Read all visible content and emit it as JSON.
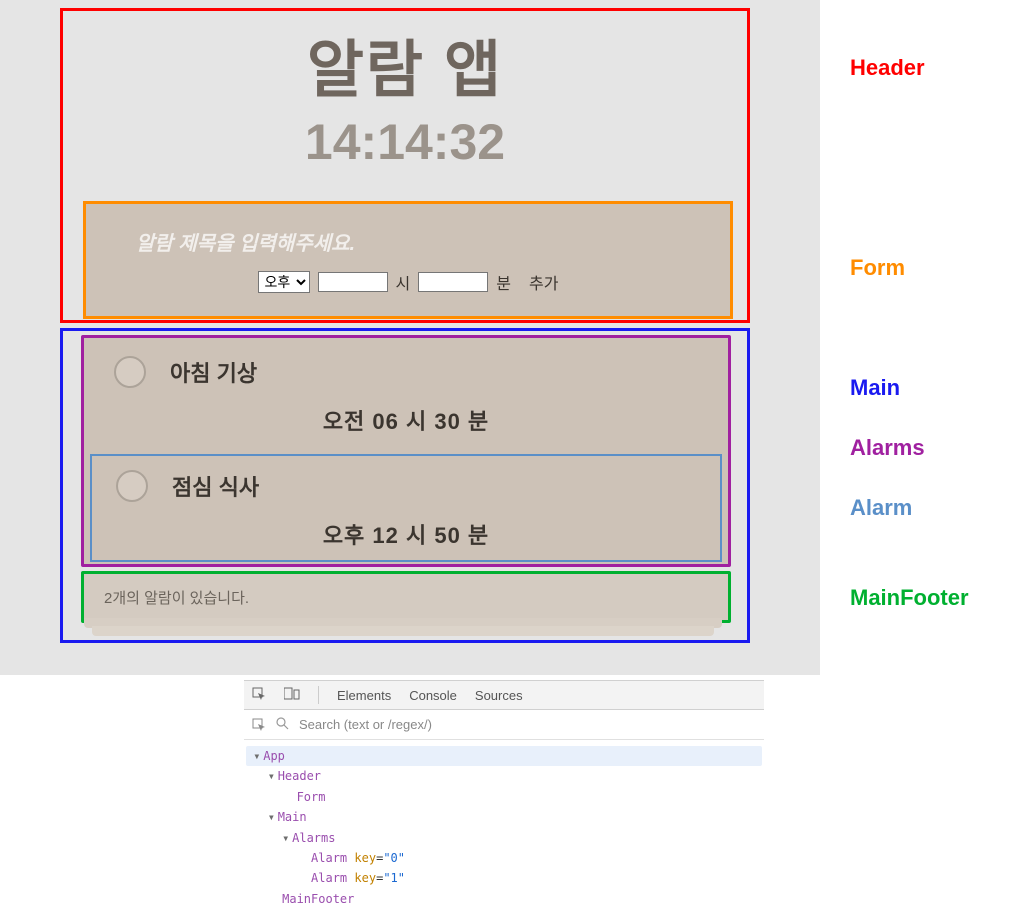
{
  "header": {
    "title": "알람 앱",
    "time": "14:14:32"
  },
  "form": {
    "placeholder": "알람 제목을 입력해주세요.",
    "ampm_selected": "오후",
    "hour_value": "",
    "hour_label": "시",
    "minute_value": "",
    "minute_label": "분",
    "add_label": "추가"
  },
  "alarms": [
    {
      "title": "아침 기상",
      "time": "오전 06 시 30 분"
    },
    {
      "title": "점심 식사",
      "time": "오후 12 시 50 분"
    }
  ],
  "mainfooter": {
    "text": "2개의 알람이 있습니다."
  },
  "labels": {
    "header": "Header",
    "form": "Form",
    "main": "Main",
    "alarms": "Alarms",
    "alarm": "Alarm",
    "mainfooter": "MainFooter"
  },
  "devtools": {
    "tabs": {
      "elements": "Elements",
      "console": "Console",
      "sources": "Sources"
    },
    "search_placeholder": "Search (text or /regex/)",
    "tree": {
      "app": "App",
      "header": "Header",
      "form": "Form",
      "main": "Main",
      "alarms": "Alarms",
      "alarm": "Alarm",
      "mainfooter": "MainFooter",
      "key_attr": "key",
      "key0": "\"0\"",
      "key1": "\"1\""
    }
  }
}
